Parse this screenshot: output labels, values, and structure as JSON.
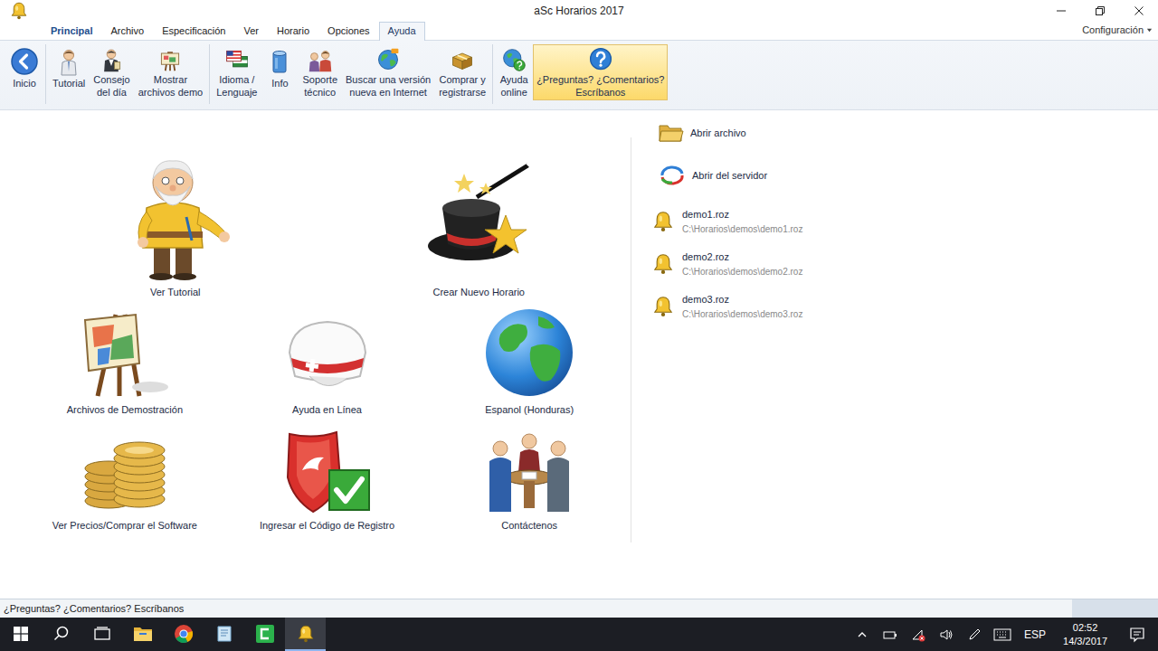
{
  "window": {
    "title": "aSc Horarios 2017"
  },
  "menu": {
    "tabs": [
      {
        "label": "Principal",
        "kind": "app",
        "selected": false
      },
      {
        "label": "Archivo",
        "kind": "tab",
        "selected": false
      },
      {
        "label": "Especificación",
        "kind": "tab",
        "selected": false
      },
      {
        "label": "Ver",
        "kind": "tab",
        "selected": false
      },
      {
        "label": "Horario",
        "kind": "tab",
        "selected": false
      },
      {
        "label": "Opciones",
        "kind": "tab",
        "selected": false
      },
      {
        "label": "Ayuda",
        "kind": "tab",
        "selected": true
      }
    ],
    "settings": "Configuración"
  },
  "ribbon": {
    "groups": [
      [
        {
          "lines": [
            "Inicio"
          ],
          "highlighted": false
        }
      ],
      [
        {
          "lines": [
            "Tutorial"
          ],
          "highlighted": false
        },
        {
          "lines": [
            "Consejo",
            "del día"
          ],
          "highlighted": false
        },
        {
          "lines": [
            "Mostrar",
            "archivos demo"
          ],
          "highlighted": false
        }
      ],
      [
        {
          "lines": [
            "Idioma /",
            "Lenguaje"
          ],
          "highlighted": false
        },
        {
          "lines": [
            "Info"
          ],
          "highlighted": false
        },
        {
          "lines": [
            "Soporte",
            "técnico"
          ],
          "highlighted": false
        },
        {
          "lines": [
            "Buscar una versión",
            "nueva en Internet"
          ],
          "highlighted": false
        },
        {
          "lines": [
            "Comprar y",
            "registrarse"
          ],
          "highlighted": false
        }
      ],
      [
        {
          "lines": [
            "Ayuda",
            "online"
          ],
          "highlighted": false
        },
        {
          "lines": [
            "¿Preguntas? ¿Comentarios?",
            "Escríbanos"
          ],
          "highlighted": true
        }
      ]
    ]
  },
  "home": {
    "rows": [
      [
        "Ver Tutorial",
        "Crear Nuevo Horario"
      ],
      [
        "Archivos de Demostración",
        "Ayuda en Línea",
        "Espanol (Honduras)"
      ],
      [
        "Ver Precios/Comprar el Software",
        "Ingresar el Código de Registro",
        "Contáctenos"
      ]
    ]
  },
  "recent": {
    "actions": [
      "Abrir archivo",
      "Abrir del servidor"
    ],
    "files": [
      {
        "name": "demo1.roz",
        "path": "C:\\Horarios\\demos\\demo1.roz"
      },
      {
        "name": "demo2.roz",
        "path": "C:\\Horarios\\demos\\demo2.roz"
      },
      {
        "name": "demo3.roz",
        "path": "C:\\Horarios\\demos\\demo3.roz"
      }
    ]
  },
  "status_bar": {
    "text": "¿Preguntas? ¿Comentarios? Escríbanos"
  },
  "taskbar": {
    "apps": [
      {
        "active": false
      },
      {
        "active": false
      },
      {
        "active": false
      },
      {
        "active": false
      },
      {
        "active": false
      },
      {
        "active": false
      },
      {
        "active": false
      },
      {
        "active": true
      }
    ],
    "language": "ESP",
    "time": "02:52",
    "date": "14/3/2017"
  }
}
